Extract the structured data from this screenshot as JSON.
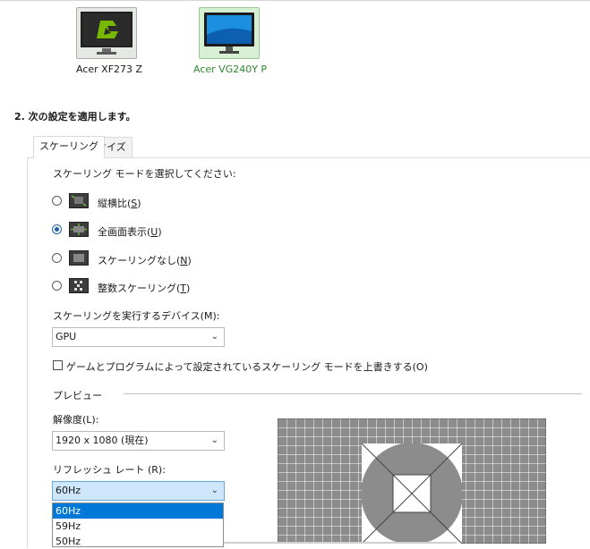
{
  "monitors": [
    {
      "label": "Acer XF273 Z",
      "icon": "nvidia-logo-monitor-icon",
      "selected": false
    },
    {
      "label": "Acer VG240Y P",
      "icon": "desktop-monitor-icon",
      "selected": true
    }
  ],
  "step_title": "2. 次の設定を適用します。",
  "tabs": [
    {
      "label": "スケーリング",
      "active": true
    },
    {
      "label": "サイズ",
      "active": false
    }
  ],
  "scaling": {
    "prompt": "スケーリング モードを選択してください:",
    "options": [
      {
        "label": "縦横比",
        "hotkey": "S",
        "checked": false,
        "icon": "aspect-ratio-icon"
      },
      {
        "label": "全画面表示",
        "hotkey": "U",
        "checked": true,
        "icon": "fullscreen-icon"
      },
      {
        "label": "スケーリングなし",
        "hotkey": "N",
        "checked": false,
        "icon": "no-scaling-icon"
      },
      {
        "label": "整数スケーリング",
        "hotkey": "T",
        "checked": false,
        "icon": "integer-scaling-icon"
      }
    ],
    "device_label": "スケーリングを実行するデバイス(M):",
    "device_value": "GPU",
    "override_label": "ゲームとプログラムによって設定されているスケーリング モードを上書きする(O)",
    "override_checked": false
  },
  "preview": {
    "section_label": "プレビュー",
    "resolution_label": "解像度(L):",
    "resolution_value": "1920 x 1080 (現在)",
    "refresh_label": "リフレッシュ レート (R):",
    "refresh_value": "60Hz",
    "refresh_options": [
      "60Hz",
      "59Hz",
      "50Hz"
    ],
    "refresh_highlight": "60Hz"
  },
  "colors": {
    "selected_monitor_text": "#2f8a2b",
    "accent": "#0078d7",
    "radio_accent": "#1d5ea8",
    "preview_gray": "#8c8c8c"
  }
}
